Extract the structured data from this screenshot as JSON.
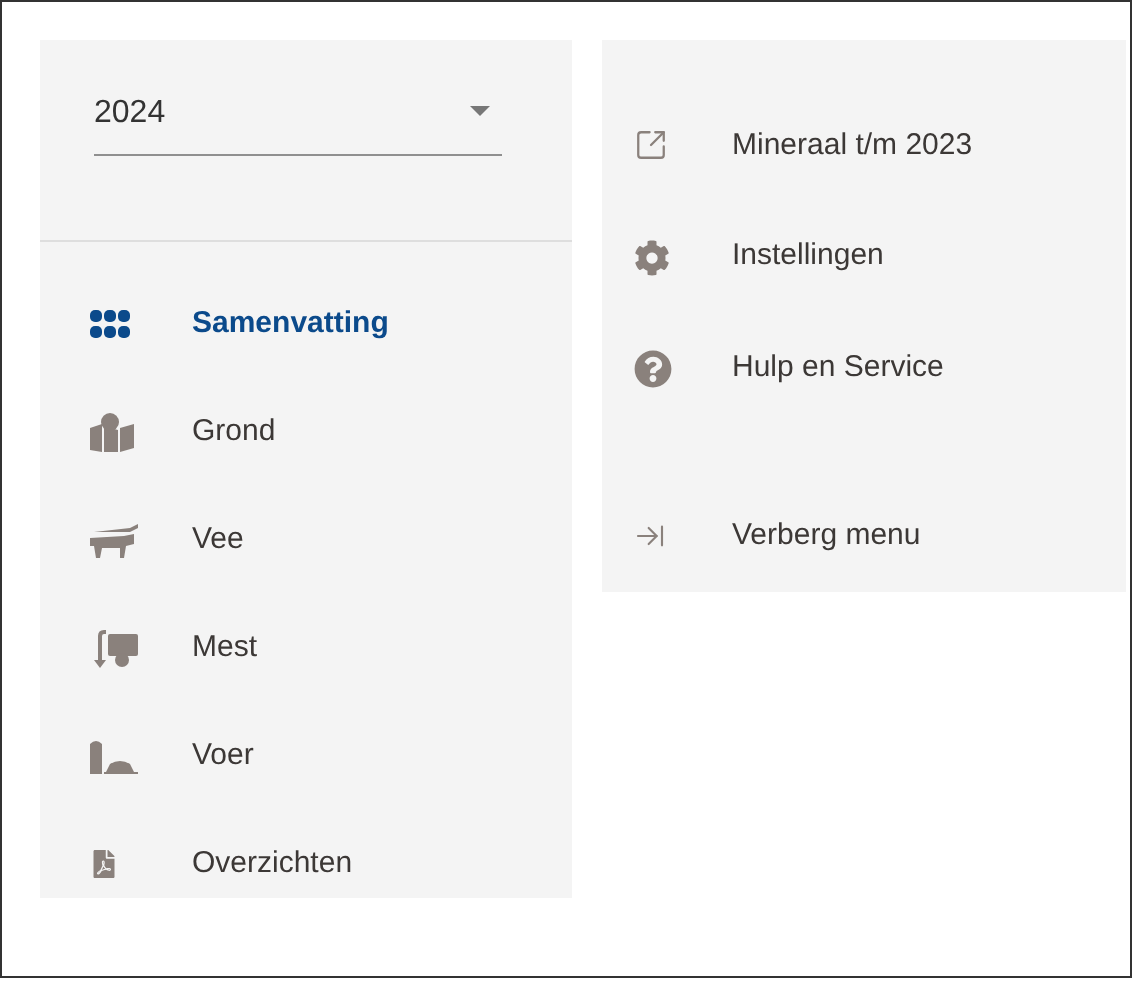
{
  "year_select": {
    "value": "2024"
  },
  "nav": [
    {
      "label": "Samenvatting",
      "kind": "summary",
      "selected": true
    },
    {
      "label": "Grond",
      "kind": "land",
      "selected": false
    },
    {
      "label": "Vee",
      "kind": "cattle",
      "selected": false
    },
    {
      "label": "Mest",
      "kind": "manure",
      "selected": false
    },
    {
      "label": "Voer",
      "kind": "feed",
      "selected": false
    },
    {
      "label": "Overzichten",
      "kind": "pdf",
      "selected": false
    }
  ],
  "menu": [
    {
      "label": "Mineraal t/m 2023",
      "kind": "external"
    },
    {
      "label": "Instellingen",
      "kind": "settings"
    },
    {
      "label": "Hulp en Service",
      "kind": "help"
    },
    {
      "label": "Verberg menu",
      "kind": "collapse"
    }
  ]
}
